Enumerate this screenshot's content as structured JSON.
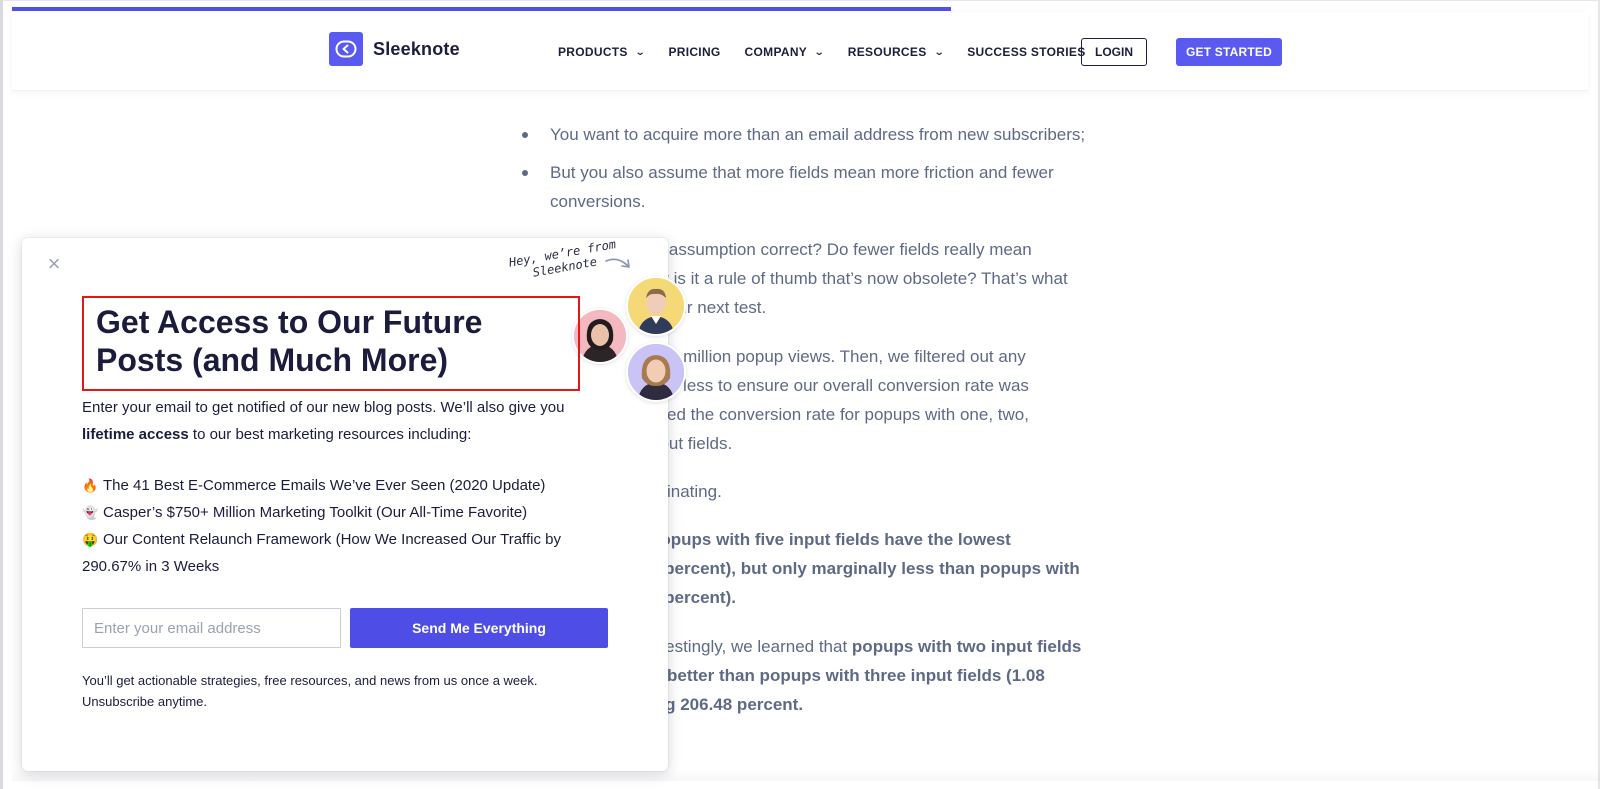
{
  "header": {
    "logo_text": "Sleeknote",
    "nav": [
      {
        "label": "PRODUCTS",
        "has_dropdown": true
      },
      {
        "label": "PRICING",
        "has_dropdown": false
      },
      {
        "label": "COMPANY",
        "has_dropdown": true
      },
      {
        "label": "RESOURCES",
        "has_dropdown": true
      },
      {
        "label": "SUCCESS STORIES",
        "has_dropdown": false
      }
    ],
    "login_label": "LOGIN",
    "get_started_label": "GET STARTED",
    "chevron_glyph": "⌄"
  },
  "article": {
    "bullets": [
      "You want to acquire more than an email address from new subscribers;",
      "But you also assume that more fields mean more friction and fewer conversions."
    ],
    "para1": "at assumption correct? Do fewer fields really mean\nOr is it a rule of thumb that’s now obsolete? That’s what\nin our next test.",
    "para2": "at 1 million popup views. Then, we filtered out any\ns or less to ensure our overall conversion rate was\nyzed the conversion rate for popups with one, two,\nnput fields.",
    "para3": "scinating.",
    "para4_bold": "popups with five input fields have the lowest\n1 percent), but only marginally less than popups with\n0 percent).",
    "para5_regular": "erestingly, we learned that ",
    "para5_bold": "popups with two input fields\nrt better than popups with three input fields (1.08\ning 206.48 percent."
  },
  "popup": {
    "close_glyph": "×",
    "tagline": "Hey, we’re from Sleeknote",
    "title": "Get Access to Our Future Posts (and Much More)",
    "intro_regular_1": "Enter your email to get notified of our new blog posts. We’ll also give you ",
    "intro_bold": "lifetime access",
    "intro_regular_2": " to our best marketing resources including:",
    "resources": [
      {
        "emoji": "🔥",
        "text": "The 41 Best E-Commerce Emails We’ve Ever Seen (2020 Update)"
      },
      {
        "emoji": "👻",
        "text": "Casper’s $750+ Million Marketing Toolkit (Our All-Time Favorite)"
      },
      {
        "emoji": "🤑",
        "text": "Our Content Relaunch Framework (How We Increased Our Traffic by 290.67% in 3 Weeks"
      }
    ],
    "email_placeholder": "Enter your email address",
    "submit_label": "Send Me Everything",
    "fineprint": "You’ll get actionable strategies, free resources, and news from us once a week. Unsubscribe anytime."
  },
  "colors": {
    "brand": "#5a5af0",
    "title_highlight": "#e01818",
    "body_text": "#5e6a85"
  }
}
